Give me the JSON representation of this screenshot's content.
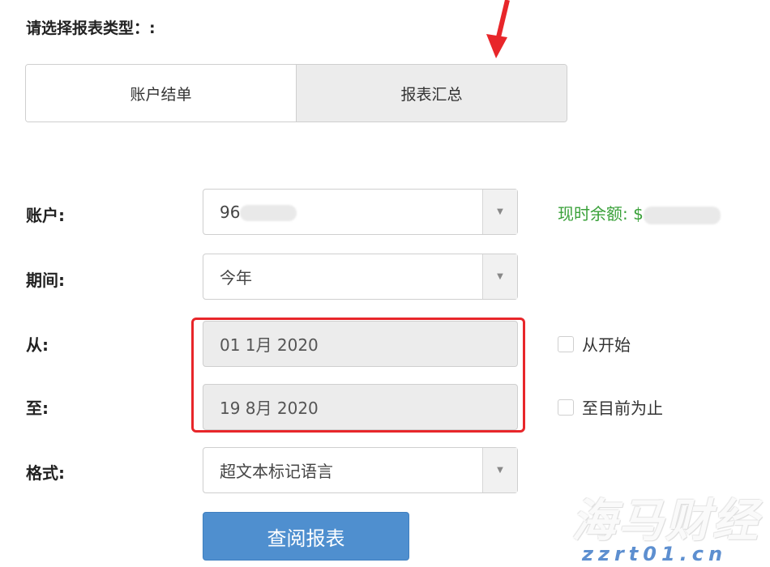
{
  "prompt": "请选择报表类型：:",
  "tabs": [
    {
      "label": "账户结单",
      "active": false
    },
    {
      "label": "报表汇总",
      "active": true
    }
  ],
  "form": {
    "account_label": "账户:",
    "account_value": "96",
    "balance_label": "现时余额: $",
    "period_label": "期间:",
    "period_value": "今年",
    "from_label": "从:",
    "from_value": "01 1月 2020",
    "from_check": "从开始",
    "to_label": "至:",
    "to_value": "19 8月 2020",
    "to_check": "至目前为止",
    "format_label": "格式:",
    "format_value": "超文本标记语言"
  },
  "submit_label": "查阅报表",
  "watermark": {
    "brand": "海马财经",
    "site": "zzrt01.cn"
  },
  "colors": {
    "accent": "#4f8fcf",
    "balance": "#3aa13a",
    "highlight": "#e8262a"
  }
}
